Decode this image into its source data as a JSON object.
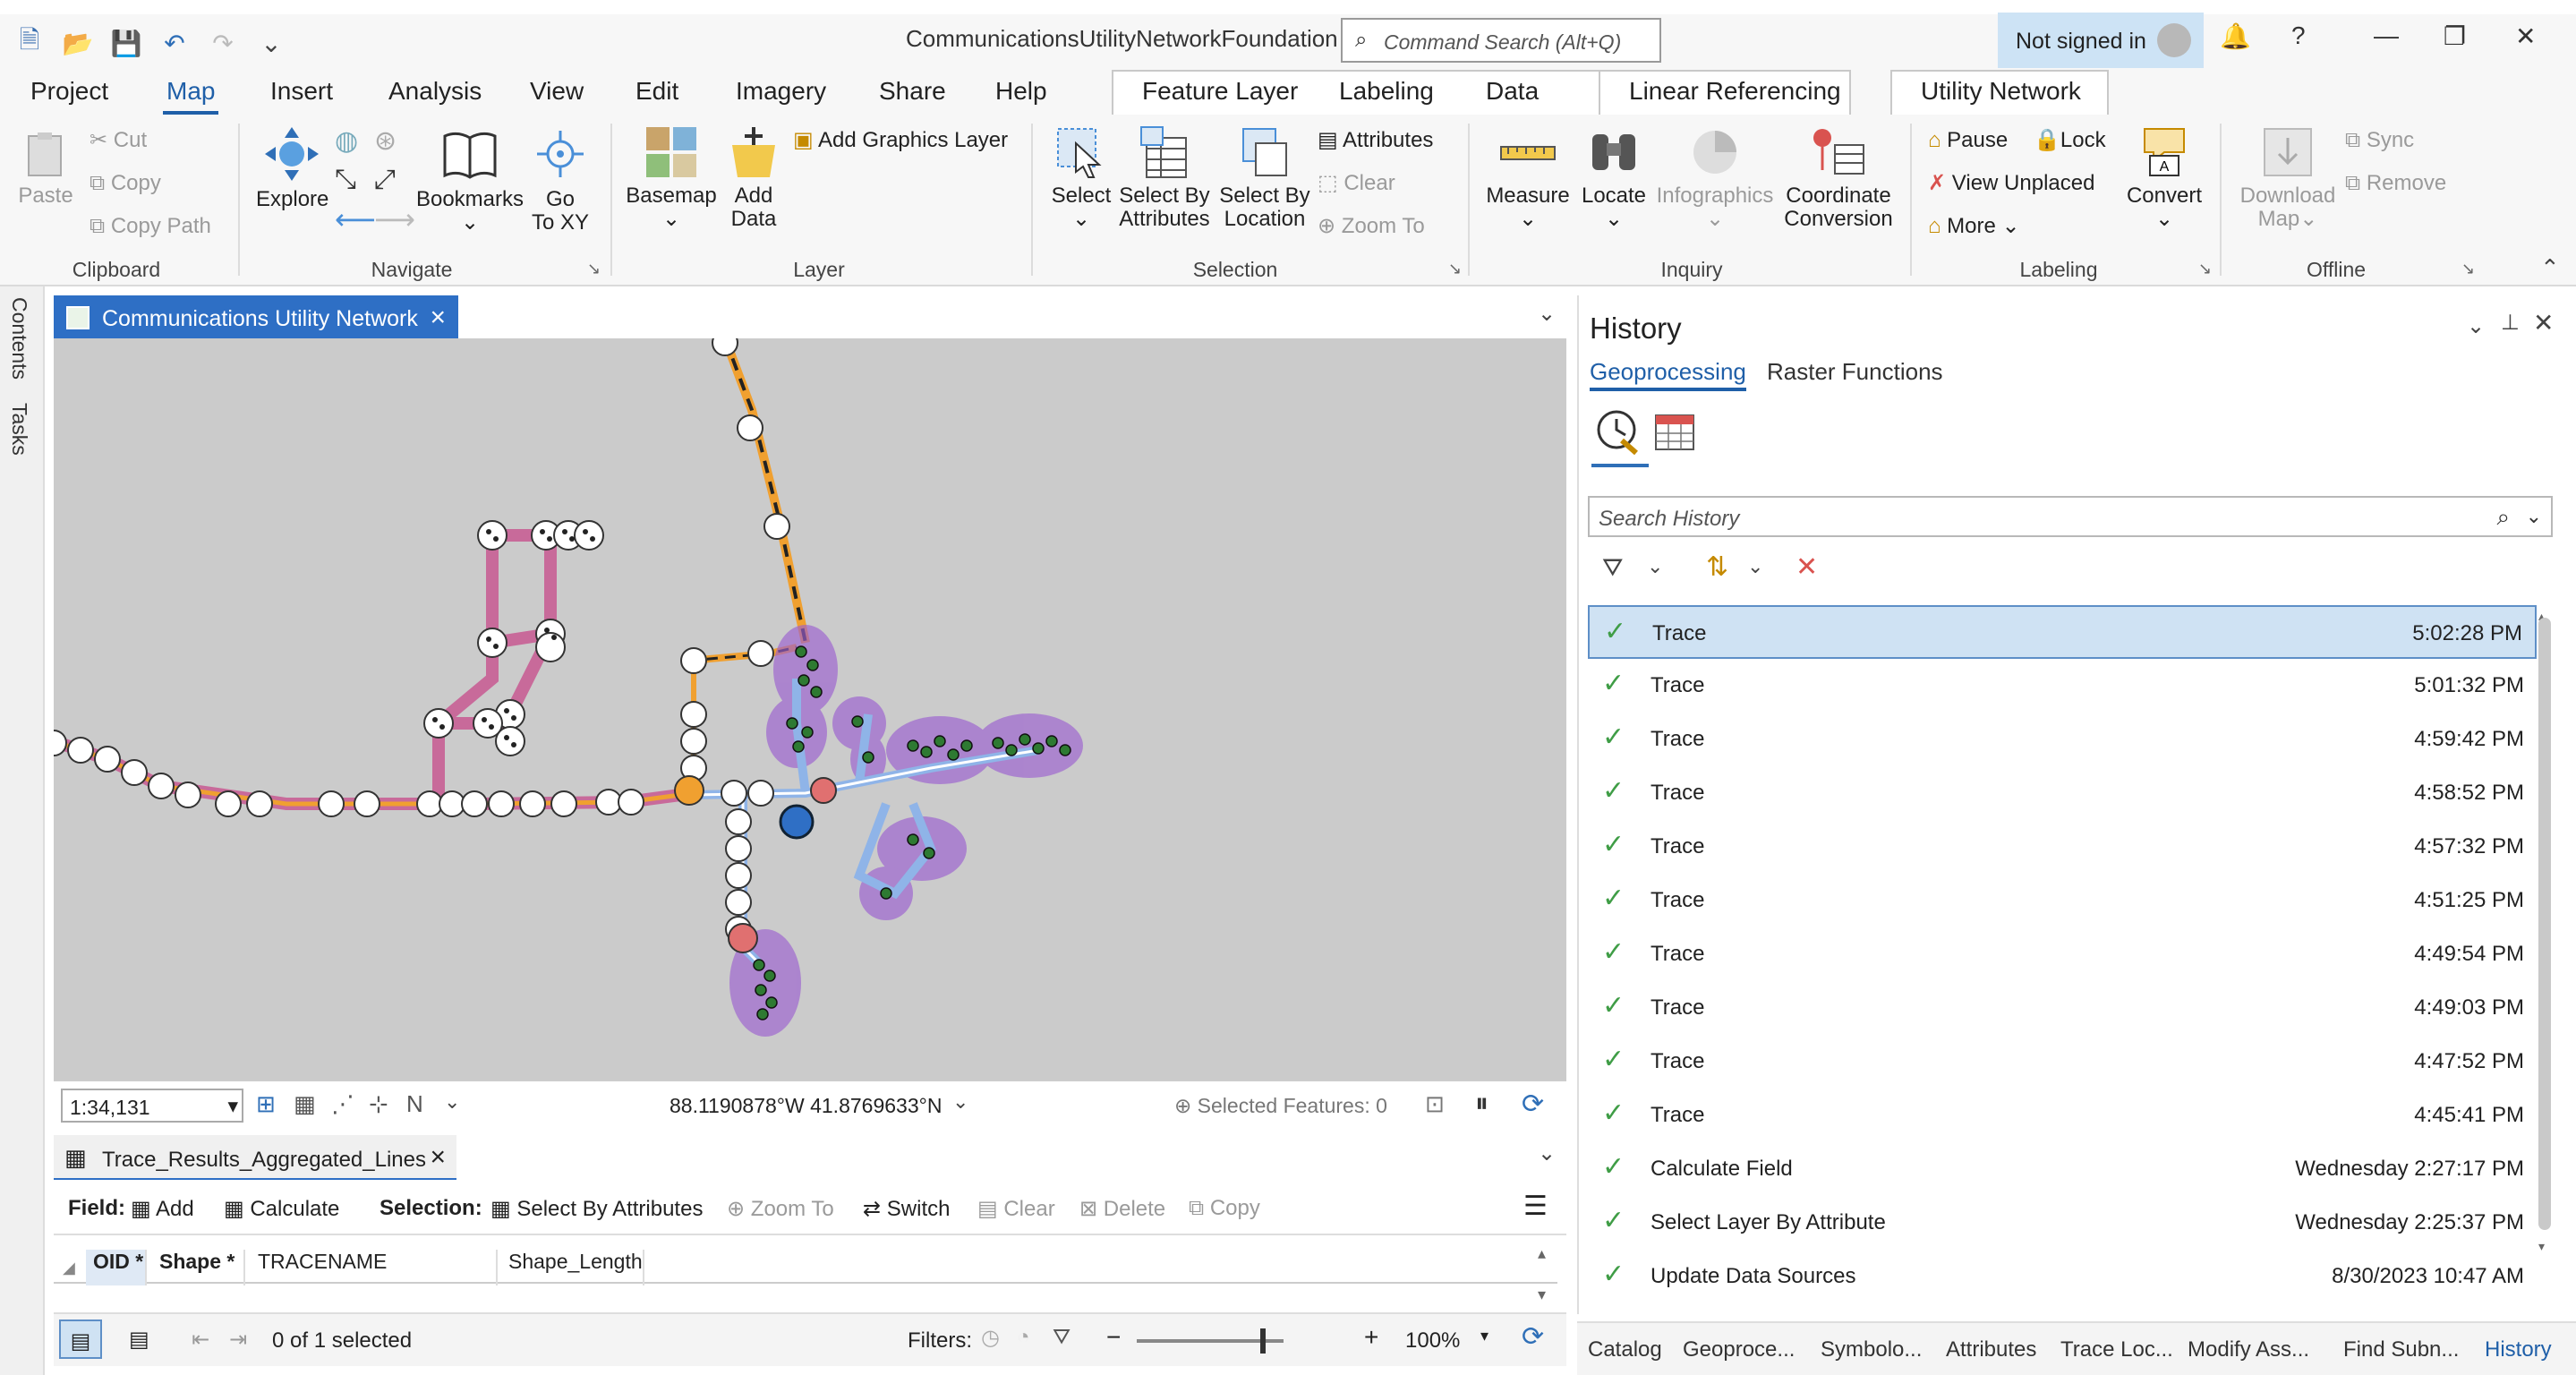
{
  "window": {
    "title": "CommunicationsUtilityNetworkFoundation",
    "command_search_placeholder": "Command Search (Alt+Q)",
    "signin": "Not signed in",
    "help": "?"
  },
  "menu_tabs": [
    "Project",
    "Map",
    "Insert",
    "Analysis",
    "View",
    "Edit",
    "Imagery",
    "Share",
    "Help"
  ],
  "context_tabs": [
    "Feature Layer",
    "Labeling",
    "Data",
    "Linear Referencing",
    "Utility Network"
  ],
  "ribbon": {
    "clipboard": {
      "label": "Clipboard",
      "paste": "Paste",
      "cut": "Cut",
      "copy": "Copy",
      "copy_path": "Copy Path"
    },
    "navigate": {
      "label": "Navigate",
      "explore": "Explore",
      "bookmarks": "Bookmarks",
      "goto": "Go\nTo XY",
      "goto_1": "Go",
      "goto_2": "To XY"
    },
    "layer": {
      "label": "Layer",
      "basemap": "Basemap",
      "add_data_1": "Add",
      "add_data_2": "Data",
      "add_graphics": "Add Graphics Layer"
    },
    "selection": {
      "label": "Selection",
      "select": "Select",
      "sba_1": "Select By",
      "sba_2": "Attributes",
      "sbl_1": "Select By",
      "sbl_2": "Location",
      "attributes": "Attributes",
      "clear": "Clear",
      "zoom_to": "Zoom To"
    },
    "inquiry": {
      "label": "Inquiry",
      "measure": "Measure",
      "locate": "Locate",
      "infographics": "Infographics",
      "coord_1": "Coordinate",
      "coord_2": "Conversion"
    },
    "labeling": {
      "label": "Labeling",
      "pause": "Pause",
      "lock": "Lock",
      "view_unplaced": "View Unplaced",
      "more": "More",
      "convert": "Convert"
    },
    "offline": {
      "label": "Offline",
      "download_1": "Download",
      "download_2": "Map",
      "sync": "Sync",
      "remove": "Remove"
    }
  },
  "left_tabs": [
    "Contents",
    "Tasks"
  ],
  "map": {
    "tab_title": "Communications Utility Network",
    "scale": "1:34,131",
    "coords": "88.1190878°W 41.8769633°N",
    "selected_features": "Selected Features: 0"
  },
  "table": {
    "tab_title": "Trace_Results_Aggregated_Lines",
    "field_label": "Field:",
    "add": "Add",
    "calculate": "Calculate",
    "selection_label": "Selection:",
    "select_by_attributes": "Select By Attributes",
    "zoom_to": "Zoom To",
    "switch": "Switch",
    "clear": "Clear",
    "delete": "Delete",
    "copy": "Copy",
    "columns": [
      "OID *",
      "Shape *",
      "TRACENAME",
      "Shape_Length"
    ],
    "selected_count": "0 of 1 selected",
    "filters_label": "Filters:",
    "zoom": "100%"
  },
  "history": {
    "title": "History",
    "tabs": [
      "Geoprocessing",
      "Raster Functions"
    ],
    "search_placeholder": "Search History",
    "items": [
      {
        "name": "Trace",
        "time": "5:02:28 PM",
        "selected": true
      },
      {
        "name": "Trace",
        "time": "5:01:32 PM"
      },
      {
        "name": "Trace",
        "time": "4:59:42 PM"
      },
      {
        "name": "Trace",
        "time": "4:58:52 PM"
      },
      {
        "name": "Trace",
        "time": "4:57:32 PM"
      },
      {
        "name": "Trace",
        "time": "4:51:25 PM"
      },
      {
        "name": "Trace",
        "time": "4:49:54 PM"
      },
      {
        "name": "Trace",
        "time": "4:49:03 PM"
      },
      {
        "name": "Trace",
        "time": "4:47:52 PM"
      },
      {
        "name": "Trace",
        "time": "4:45:41 PM"
      },
      {
        "name": "Calculate Field",
        "time": "Wednesday 2:27:17 PM"
      },
      {
        "name": "Select Layer By Attribute",
        "time": "Wednesday 2:25:37 PM"
      },
      {
        "name": "Update Data Sources",
        "time": "8/30/2023 10:47 AM"
      }
    ]
  },
  "bottom_tabs": [
    "Catalog",
    "Geoproce...",
    "Symbolo...",
    "Attributes",
    "Trace Loc...",
    "Modify Ass...",
    "Find Subn...",
    "History"
  ],
  "colors": {
    "accent": "#1f5fa8",
    "map_bg": "#cbcbcb",
    "selected_row": "#cfe2f3",
    "check": "#3f9d46",
    "trace_blue": "#8fb4e8",
    "pink_line": "#c86a9a",
    "orange_line": "#f0a030",
    "purple_halo": "#9b5fd0"
  }
}
